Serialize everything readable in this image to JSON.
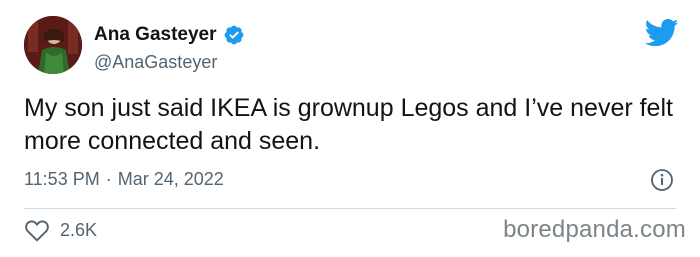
{
  "author": {
    "display_name": "Ana Gasteyer",
    "handle": "@AnaGasteyer",
    "verified": true
  },
  "tweet": {
    "text": "My son just said IKEA is grownup Legos and I’ve never felt more connected and seen.",
    "time": "11:53 PM",
    "separator": "·",
    "date": "Mar 24, 2022"
  },
  "actions": {
    "like_count": "2.6K"
  },
  "watermark": "boredpanda.com",
  "icons": {
    "platform": "twitter-bird-icon",
    "verified": "verified-badge-icon",
    "info": "info-icon",
    "like": "heart-icon"
  },
  "colors": {
    "brand_blue": "#1d9bf0",
    "text": "#0f1419",
    "muted": "#536471"
  }
}
